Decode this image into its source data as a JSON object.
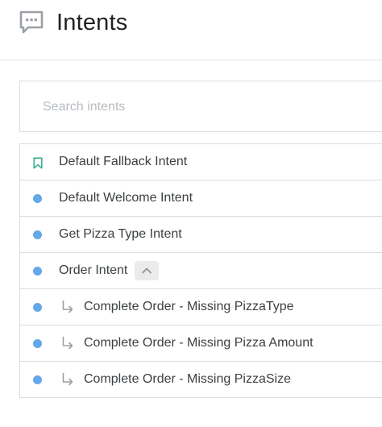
{
  "header": {
    "title": "Intents",
    "icon": "chat-bubble-icon"
  },
  "search": {
    "placeholder": "Search intents",
    "value": ""
  },
  "colors": {
    "dot": "#63a8e8",
    "bookmark": "#3bb08f",
    "border": "#dcdcdc"
  },
  "intents": [
    {
      "label": "Default Fallback Intent",
      "marker": "bookmark-icon",
      "child": false
    },
    {
      "label": "Default Welcome Intent",
      "marker": "dot",
      "child": false
    },
    {
      "label": "Get Pizza Type Intent",
      "marker": "dot",
      "child": false
    },
    {
      "label": "Order Intent",
      "marker": "dot",
      "child": false,
      "expanded": true,
      "toggle_icon": "chevron-up-icon"
    },
    {
      "label": "Complete Order - Missing PizzaType",
      "marker": "dot",
      "child": true
    },
    {
      "label": "Complete Order - Missing Pizza Amount",
      "marker": "dot",
      "child": true
    },
    {
      "label": "Complete Order - Missing PizzaSize",
      "marker": "dot",
      "child": true
    }
  ]
}
